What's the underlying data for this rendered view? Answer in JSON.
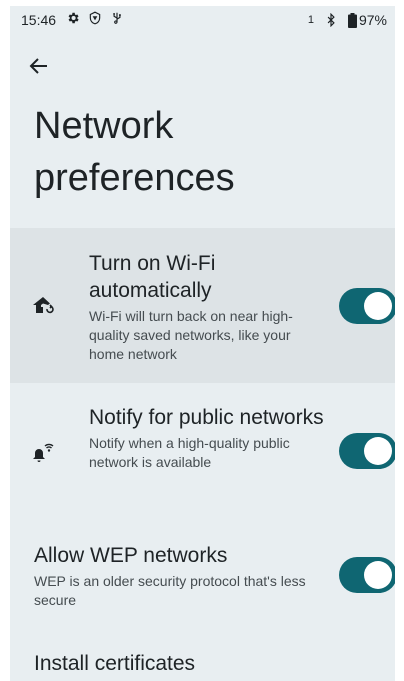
{
  "status_bar": {
    "time": "15:46",
    "icons_left": [
      "gear-icon",
      "vpn-shield-icon",
      "usb-icon"
    ],
    "sim_indicator": "1",
    "bluetooth_icon": "bluetooth-icon",
    "battery_percent": "97%"
  },
  "header": {
    "back_icon": "arrow-back-icon",
    "title": "Network preferences"
  },
  "settings": [
    {
      "title": "Turn on Wi-Fi automatically",
      "subtitle": "Wi-Fi will turn back on near high-quality saved networks, like your home network",
      "icon": "wifi-auto-home-icon",
      "enabled": true
    },
    {
      "title": "Notify for public networks",
      "subtitle": "Notify when a high-quality public network is available",
      "icon": "wifi-notification-bell-icon",
      "enabled": true
    },
    {
      "title": "Allow WEP networks",
      "subtitle": "WEP is an older security protocol that's less secure",
      "enabled": true
    }
  ],
  "install_certificates": "Install certificates",
  "colors": {
    "background": "#e8eef1",
    "highlight_row": "#dde3e6",
    "toggle_on": "#0f6672"
  }
}
